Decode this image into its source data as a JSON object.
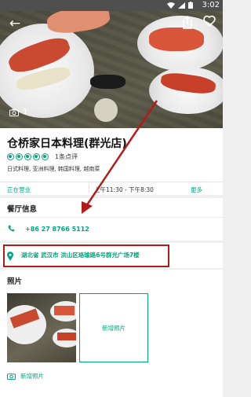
{
  "status_bar": {
    "time": "3:02"
  },
  "hero": {
    "photo_count": "1"
  },
  "restaurant": {
    "name": "仓桥家日本料理(群光店)",
    "rating_bubbles": 5,
    "review_count": "1条点评",
    "cuisines": "日式料理, 亚洲料理, 韩国料理, 越南菜"
  },
  "hours": {
    "status": "正在营业",
    "time": "上午11:30 - 下午8:30",
    "more": "更多"
  },
  "info_section": {
    "title": "餐厅信息",
    "phone": "+86 27 8766 5112",
    "address": "湖北省 武汉市 洪山区珞瑜路6号群光广场7楼"
  },
  "photos_section": {
    "title": "照片",
    "add_tile_label": "新增照片",
    "add_link_label": "新增照片"
  },
  "colors": {
    "accent": "#00a680",
    "annotation": "#b51a1a",
    "status_bar": "#4f4f4f"
  }
}
